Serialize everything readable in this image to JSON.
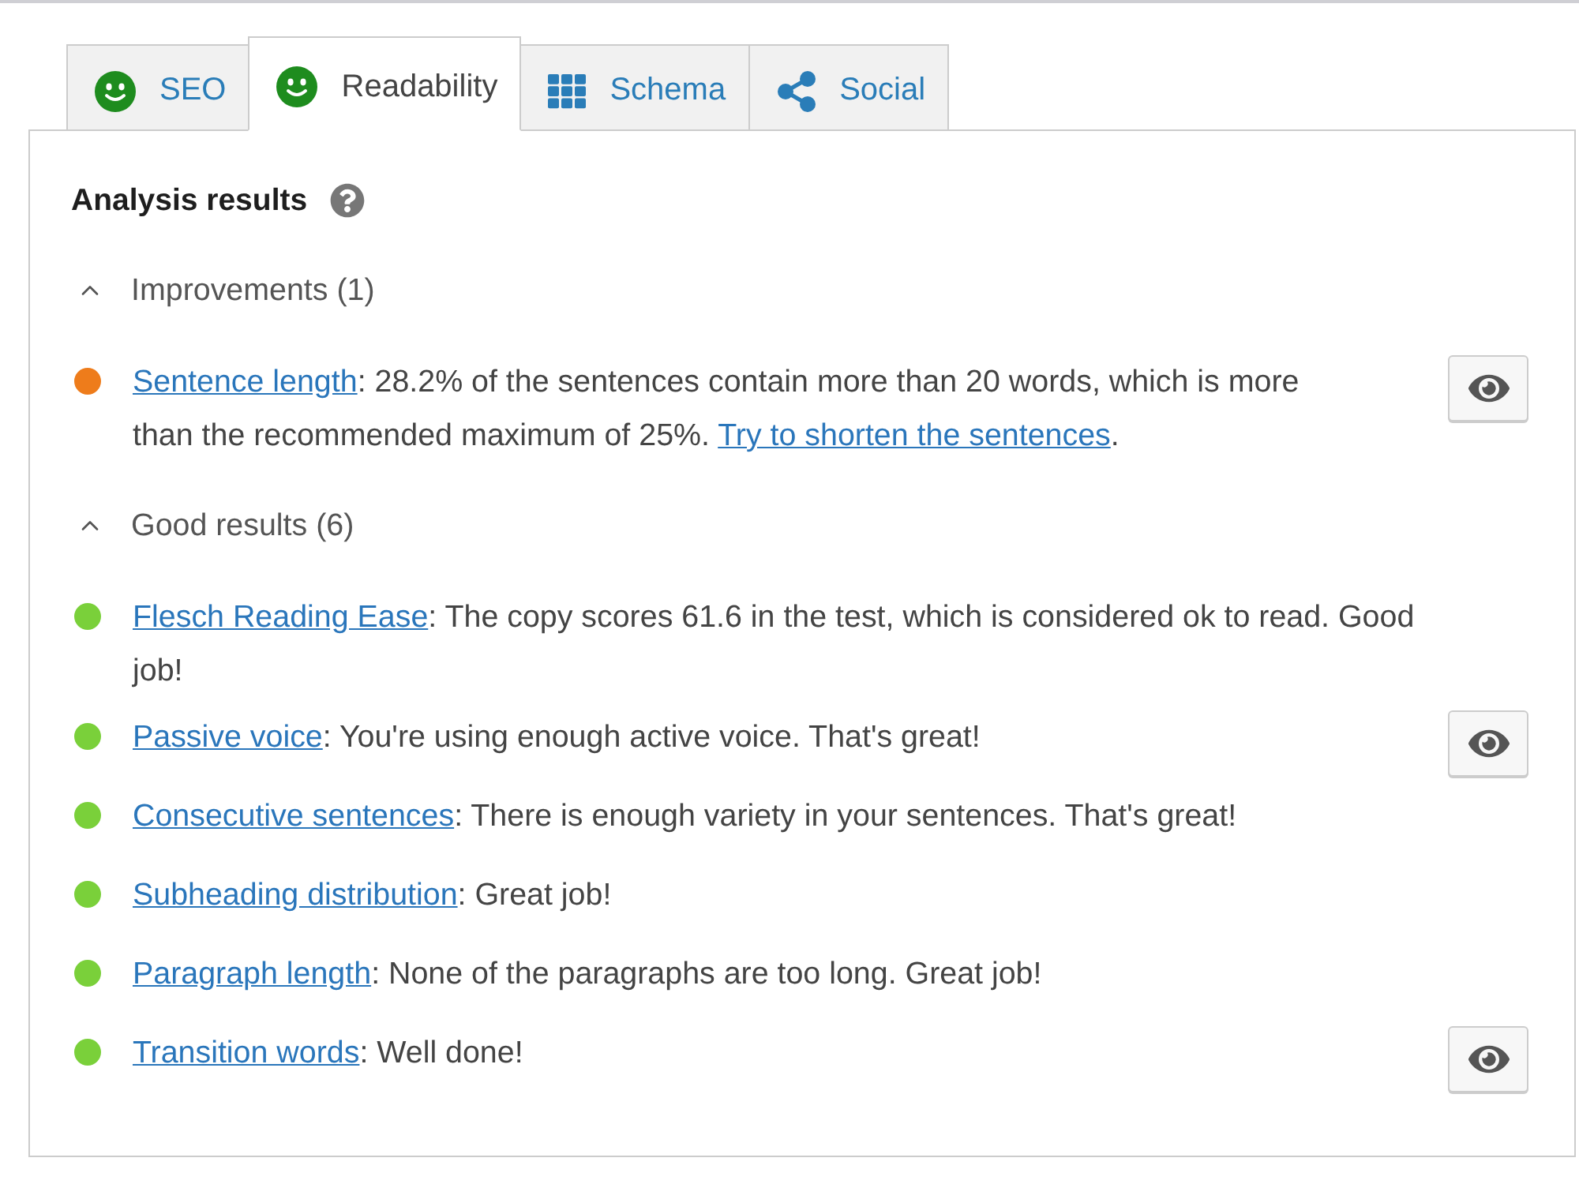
{
  "tabs": [
    {
      "label": "SEO",
      "selected": false
    },
    {
      "label": "Readability",
      "selected": true
    },
    {
      "label": "Schema",
      "selected": false
    },
    {
      "label": "Social",
      "selected": false
    }
  ],
  "panel": {
    "title": "Analysis results",
    "sections": [
      {
        "title": "Improvements (1)",
        "expanded": true,
        "results": [
          {
            "color": "#ee7c1b",
            "eye_button": true,
            "parts": [
              {
                "kind": "link",
                "text": "Sentence length"
              },
              {
                "kind": "text",
                "text": ": 28.2% of the sentences contain more than 20 words, which is more than the recommended maximum of 25%. "
              },
              {
                "kind": "link",
                "text": "Try to shorten the sentences"
              },
              {
                "kind": "text",
                "text": "."
              }
            ]
          }
        ]
      },
      {
        "title": "Good results (6)",
        "expanded": true,
        "results": [
          {
            "color": "#7ad03a",
            "eye_button": false,
            "parts": [
              {
                "kind": "link",
                "text": "Flesch Reading Ease"
              },
              {
                "kind": "text",
                "text": ": The copy scores 61.6 in the test, which is considered ok to read. Good job!"
              }
            ]
          },
          {
            "color": "#7ad03a",
            "eye_button": true,
            "parts": [
              {
                "kind": "link",
                "text": "Passive voice"
              },
              {
                "kind": "text",
                "text": ": You're using enough active voice. That's great!"
              }
            ]
          },
          {
            "color": "#7ad03a",
            "eye_button": false,
            "parts": [
              {
                "kind": "link",
                "text": "Consecutive sentences"
              },
              {
                "kind": "text",
                "text": ": There is enough variety in your sentences. That's great!"
              }
            ]
          },
          {
            "color": "#7ad03a",
            "eye_button": false,
            "parts": [
              {
                "kind": "link",
                "text": "Subheading distribution"
              },
              {
                "kind": "text",
                "text": ": Great job!"
              }
            ]
          },
          {
            "color": "#7ad03a",
            "eye_button": false,
            "parts": [
              {
                "kind": "link",
                "text": "Paragraph length"
              },
              {
                "kind": "text",
                "text": ": None of the paragraphs are too long. Great job!"
              }
            ]
          },
          {
            "color": "#7ad03a",
            "eye_button": true,
            "parts": [
              {
                "kind": "link",
                "text": "Transition words"
              },
              {
                "kind": "text",
                "text": ": Well done!"
              }
            ]
          }
        ]
      }
    ]
  }
}
